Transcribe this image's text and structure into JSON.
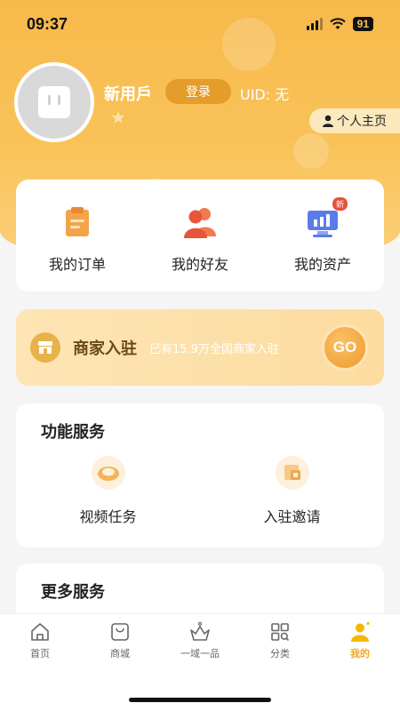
{
  "status_bar": {
    "time": "09:37",
    "battery": "91"
  },
  "profile": {
    "username": "新用戶",
    "login_label": "登录",
    "uid": "UID: 无",
    "profile_button_label": "个人主页"
  },
  "quick_actions": [
    {
      "label": "我的订单",
      "icon": "clipboard-icon"
    },
    {
      "label": "我的好友",
      "icon": "friends-icon"
    },
    {
      "label": "我的资产",
      "icon": "assets-chart-icon",
      "badge": "新"
    }
  ],
  "merchant": {
    "title": "商家入驻",
    "description": "已有15.9万全国商家入驻",
    "go_label": "GO"
  },
  "function_services": {
    "title": "功能服务",
    "items": [
      {
        "label": "视频任务",
        "icon": "video-task-icon"
      },
      {
        "label": "入驻邀请",
        "icon": "invite-icon"
      }
    ]
  },
  "more_services": {
    "title": "更多服务"
  },
  "tabbar": {
    "items": [
      {
        "label": "首页",
        "icon": "home-icon"
      },
      {
        "label": "商城",
        "icon": "shop-bag-icon"
      },
      {
        "label": "一域一品",
        "icon": "crown-icon"
      },
      {
        "label": "分类",
        "icon": "category-grid-icon"
      },
      {
        "label": "我的",
        "icon": "user-icon",
        "active": true
      }
    ]
  },
  "colors": {
    "accent": "#f2a623",
    "header_gradient_top": "#f7b94a",
    "login_button": "#e49c2a",
    "badge_red": "#e8503a"
  }
}
